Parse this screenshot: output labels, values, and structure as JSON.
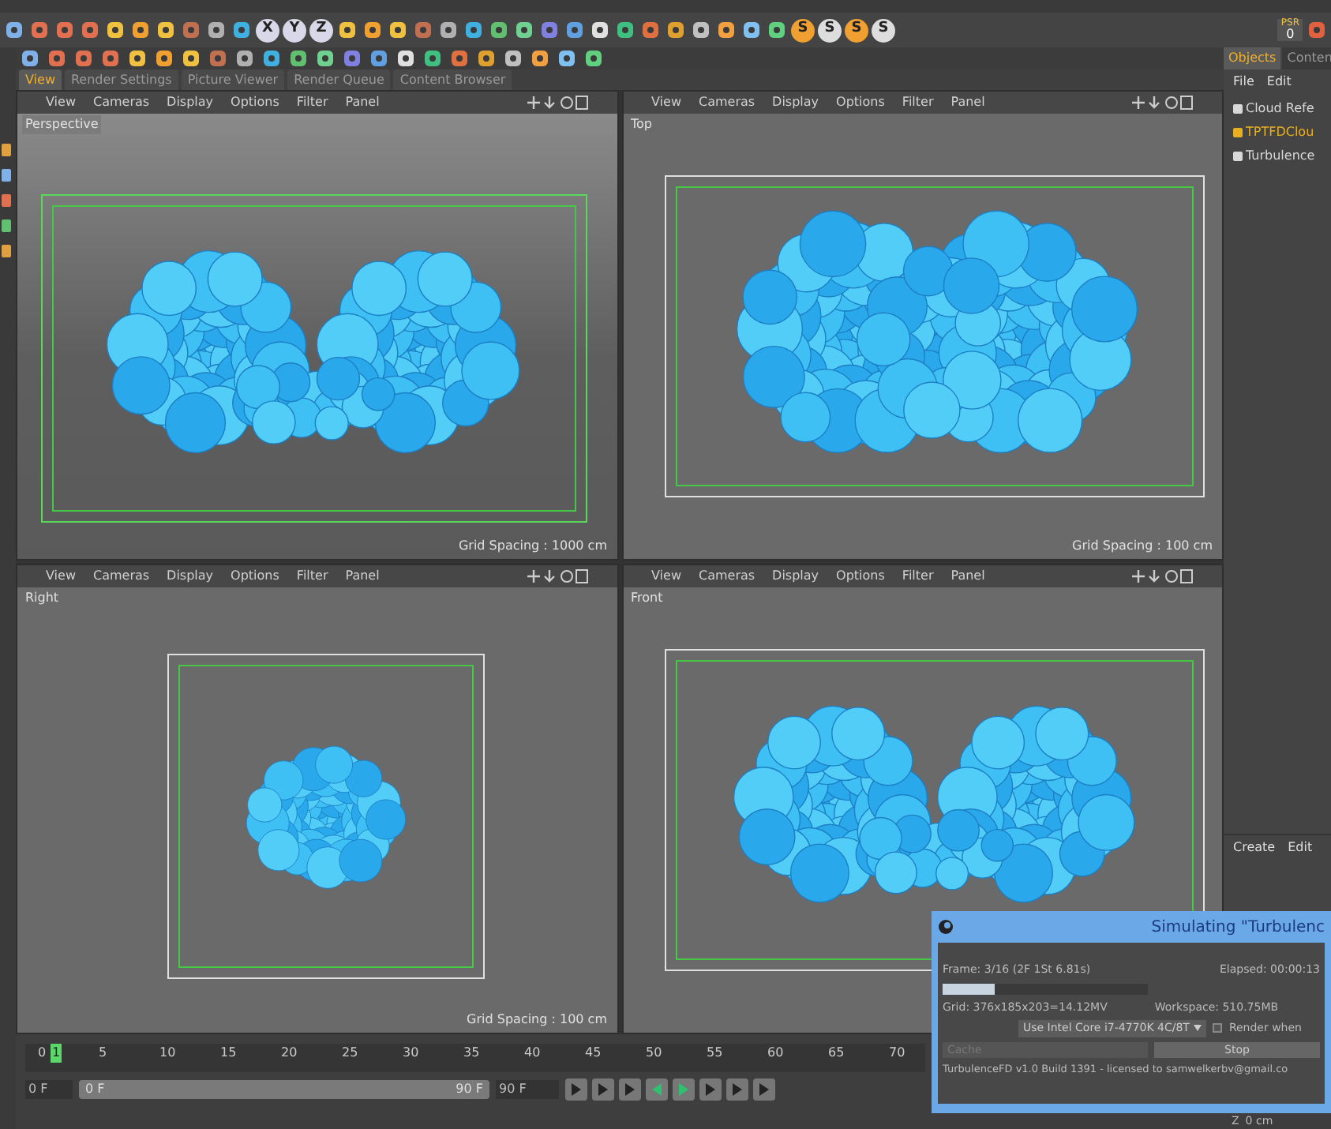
{
  "toolbar": {
    "axis_buttons": [
      "X",
      "Y",
      "Z"
    ],
    "script_buttons": [
      "S",
      "S",
      "S",
      "S"
    ],
    "psr": {
      "label": "PSR",
      "value": "0"
    }
  },
  "view_tabs": [
    {
      "label": "View",
      "selected": true
    },
    {
      "label": "Render Settings",
      "selected": false
    },
    {
      "label": "Picture Viewer",
      "selected": false
    },
    {
      "label": "Render Queue",
      "selected": false
    },
    {
      "label": "Content Browser",
      "selected": false
    }
  ],
  "viewports": [
    {
      "menu": [
        "View",
        "Cameras",
        "Display",
        "Options",
        "Filter",
        "Panel"
      ],
      "label": "Perspective",
      "grid_spacing": "Grid Spacing : 1000 cm",
      "kind": "perspective"
    },
    {
      "menu": [
        "View",
        "Cameras",
        "Display",
        "Options",
        "Filter",
        "Panel"
      ],
      "label": "Top",
      "grid_spacing": "Grid Spacing : 100 cm",
      "kind": "top"
    },
    {
      "menu": [
        "View",
        "Cameras",
        "Display",
        "Options",
        "Filter",
        "Panel"
      ],
      "label": "Right",
      "grid_spacing": "Grid Spacing : 100 cm",
      "kind": "right"
    },
    {
      "menu": [
        "View",
        "Cameras",
        "Display",
        "Options",
        "Filter",
        "Panel"
      ],
      "label": "Front",
      "kind": "front"
    }
  ],
  "objects_panel": {
    "tabs": [
      {
        "label": "Objects",
        "selected": true
      },
      {
        "label": "Conten",
        "selected": false
      }
    ],
    "menu": [
      "File",
      "Edit"
    ],
    "items": [
      {
        "name": "Cloud Refe",
        "color": "#d8d8d8"
      },
      {
        "name": "TPTFDClou",
        "color": "#e8b020"
      },
      {
        "name": "Turbulence",
        "color": "#d8d8d8"
      }
    ]
  },
  "attributes_panel": {
    "menu": [
      "Create",
      "Edit"
    ]
  },
  "timeline": {
    "ruler": [
      "0",
      "5",
      "10",
      "15",
      "20",
      "25",
      "30",
      "35",
      "40",
      "45",
      "50",
      "55",
      "60",
      "65",
      "70"
    ],
    "current_frame": "1",
    "start_field": "0 F",
    "range_start": "0 F",
    "range_end": "90 F",
    "level": 1,
    "end_field": "90 F"
  },
  "dialog": {
    "title": "Simulating \"Turbulenc",
    "frame": "Frame: 3/16 (2F 1St 6.81s)",
    "elapsed": "Elapsed: 00:00:13",
    "level": 0.25,
    "grid": "Grid: 376x185x203=14.12MV",
    "workspace": "Workspace: 510.75MB",
    "device": "Use  Intel Core i7-4770K 4C/8T",
    "render_when": {
      "label": "Render when",
      "checked": false
    },
    "cache": {
      "label": "Cache",
      "disabled": true
    },
    "stop": "Stop",
    "footer": "TurbulenceFD v1.0 Build 1391 - licensed to samwelkerbv@gmail.co"
  },
  "coordinate": {
    "axis": "Z",
    "value": "0 cm"
  }
}
